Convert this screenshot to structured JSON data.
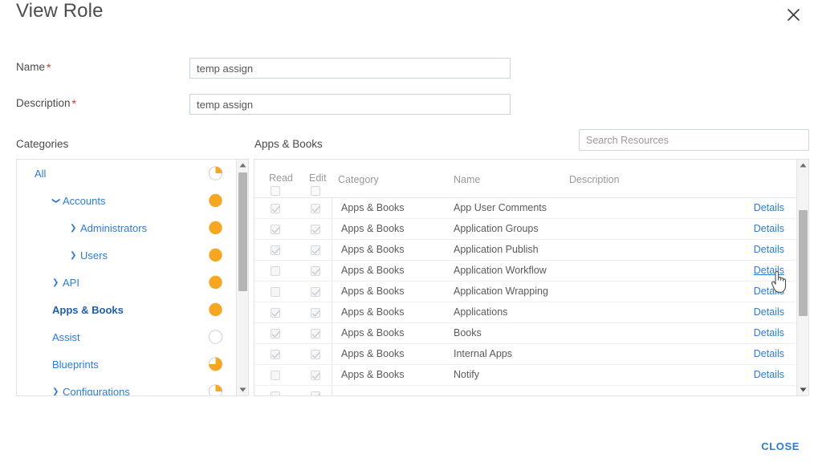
{
  "header": {
    "title": "View Role",
    "close_icon": "close-icon"
  },
  "form": {
    "name": {
      "label": "Name",
      "required": "*",
      "value": "temp assign"
    },
    "description": {
      "label": "Description",
      "required": "*",
      "value": "temp assign"
    }
  },
  "search": {
    "placeholder": "Search Resources",
    "value": ""
  },
  "sections": {
    "categories_label": "Categories",
    "resources_label": "Apps & Books"
  },
  "categories": {
    "items": [
      {
        "label": "All",
        "indent": 0,
        "caret": "none",
        "selected": false,
        "fill": 0.25
      },
      {
        "label": "Accounts",
        "indent": 1,
        "caret": "down",
        "selected": false,
        "fill": 1.0
      },
      {
        "label": "Administrators",
        "indent": 2,
        "caret": "right",
        "selected": false,
        "fill": 1.0
      },
      {
        "label": "Users",
        "indent": 2,
        "caret": "right",
        "selected": false,
        "fill": 1.0
      },
      {
        "label": "API",
        "indent": 1,
        "caret": "right",
        "selected": false,
        "fill": 1.0
      },
      {
        "label": "Apps & Books",
        "indent": 1,
        "caret": "none",
        "selected": true,
        "fill": 1.0
      },
      {
        "label": "Assist",
        "indent": 1,
        "caret": "none",
        "selected": false,
        "fill": 0.0
      },
      {
        "label": "Blueprints",
        "indent": 1,
        "caret": "none",
        "selected": false,
        "fill": 0.75
      },
      {
        "label": "Configurations",
        "indent": 1,
        "caret": "right",
        "selected": false,
        "fill": 0.25
      }
    ]
  },
  "table": {
    "columns": [
      "Read",
      "Edit",
      "Category",
      "Name",
      "Description"
    ],
    "header_checkboxes": {
      "read": false,
      "edit": false
    },
    "details_label": "Details",
    "rows": [
      {
        "read": true,
        "edit": true,
        "category": "Apps & Books",
        "name": "App User Comments",
        "description": "",
        "hovered": false
      },
      {
        "read": true,
        "edit": true,
        "category": "Apps & Books",
        "name": "Application Groups",
        "description": "",
        "hovered": false
      },
      {
        "read": true,
        "edit": true,
        "category": "Apps & Books",
        "name": "Application Publish",
        "description": "",
        "hovered": false
      },
      {
        "read": false,
        "edit": true,
        "category": "Apps & Books",
        "name": "Application Workflow",
        "description": "",
        "hovered": true
      },
      {
        "read": false,
        "edit": true,
        "category": "Apps & Books",
        "name": "Application Wrapping",
        "description": "",
        "hovered": false
      },
      {
        "read": true,
        "edit": true,
        "category": "Apps & Books",
        "name": "Applications",
        "description": "",
        "hovered": false
      },
      {
        "read": true,
        "edit": true,
        "category": "Apps & Books",
        "name": "Books",
        "description": "",
        "hovered": false
      },
      {
        "read": true,
        "edit": true,
        "category": "Apps & Books",
        "name": "Internal Apps",
        "description": "",
        "hovered": false
      },
      {
        "read": false,
        "edit": true,
        "category": "Apps & Books",
        "name": "Notify",
        "description": "",
        "hovered": false
      },
      {
        "read": false,
        "edit": true,
        "category": "",
        "name": "",
        "description": "",
        "hovered": false
      }
    ]
  },
  "footer": {
    "close_label": "CLOSE"
  },
  "colors": {
    "accent_orange": "#f5a623",
    "link_blue": "#2f7bd0",
    "required_red": "#d0342c",
    "text_gray": "#4a4a4a",
    "muted_gray": "#9a9a9a",
    "border_gray": "#dfe3e8"
  }
}
